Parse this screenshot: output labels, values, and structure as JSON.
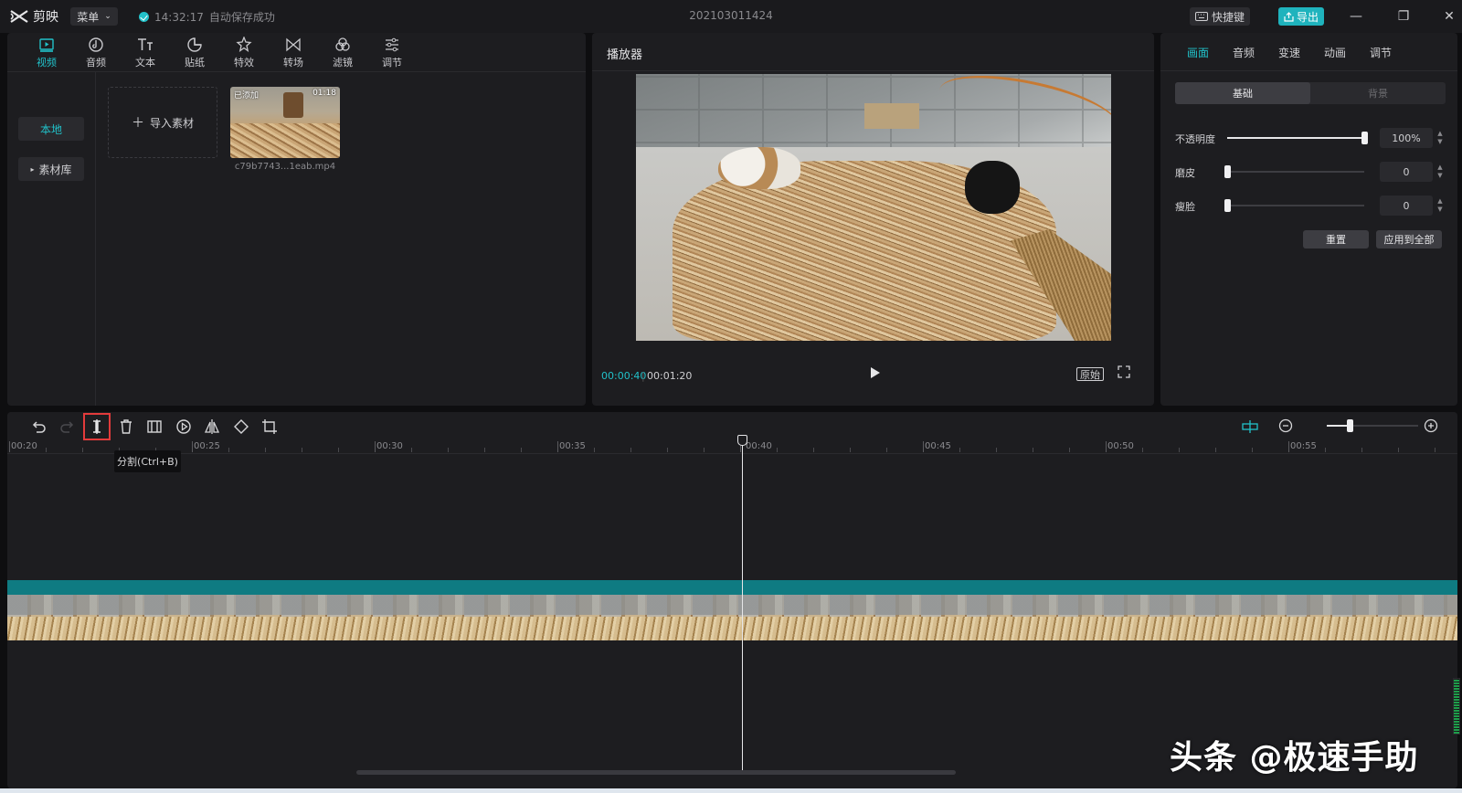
{
  "app": {
    "name": "剪映",
    "menu_label": "菜单",
    "save_time": "14:32:17",
    "save_status": "自动保存成功",
    "project_title": "202103011424"
  },
  "header": {
    "shortcut_label": "快捷键",
    "export_label": "导出"
  },
  "media": {
    "tabs": [
      {
        "label": "视频",
        "icon": "video-icon"
      },
      {
        "label": "音频",
        "icon": "audio-icon"
      },
      {
        "label": "文本",
        "icon": "text-icon"
      },
      {
        "label": "贴纸",
        "icon": "sticker-icon"
      },
      {
        "label": "特效",
        "icon": "effect-icon"
      },
      {
        "label": "转场",
        "icon": "transition-icon"
      },
      {
        "label": "滤镜",
        "icon": "filter-icon"
      },
      {
        "label": "调节",
        "icon": "adjust-icon"
      }
    ],
    "active_tab": 0,
    "side": {
      "local": "本地",
      "library": "素材库"
    },
    "import_label": "导入素材",
    "clip": {
      "tag": "已添加",
      "duration": "01:18",
      "name": "c79b7743...1eab.mp4"
    }
  },
  "player": {
    "title": "播放器",
    "time_current": "00:00:40",
    "time_total": "00:01:20",
    "ratio_label": "原始"
  },
  "properties": {
    "tabs": [
      "画面",
      "音频",
      "变速",
      "动画",
      "调节"
    ],
    "active_tab": 0,
    "segments": [
      "基础",
      "背景"
    ],
    "sliders": [
      {
        "label": "不透明度",
        "value": "100%",
        "level": 1.0
      },
      {
        "label": "磨皮",
        "value": "0",
        "level": 0.0
      },
      {
        "label": "瘦脸",
        "value": "0",
        "level": 0.0
      }
    ],
    "reset_label": "重置",
    "apply_all_label": "应用到全部"
  },
  "timeline": {
    "tooltip": "分割(Ctrl+B)",
    "ruler_labels": [
      "00:20",
      "00:25",
      "00:30",
      "00:35",
      "00:40",
      "00:45",
      "00:50",
      "00:55"
    ],
    "zoom_level": 0.25
  },
  "watermark": "头条 @极速手助",
  "colors": {
    "accent": "#21c1c9",
    "track": "#0f7b82",
    "highlight": "#e33b3b"
  }
}
